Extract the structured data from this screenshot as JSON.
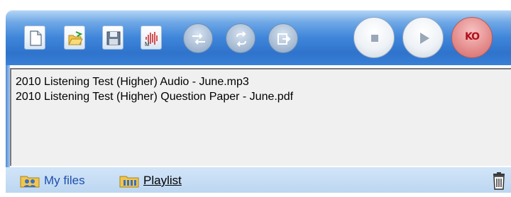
{
  "toolbar": {
    "buttons": [
      {
        "name": "new",
        "icon": "new-document-icon"
      },
      {
        "name": "open",
        "icon": "open-folder-icon"
      },
      {
        "name": "save",
        "icon": "save-disk-icon"
      },
      {
        "name": "media",
        "icon": "audio-waveform-icon"
      },
      {
        "name": "shuffle",
        "icon": "shuffle-icon"
      },
      {
        "name": "repeat",
        "icon": "repeat-icon"
      },
      {
        "name": "export",
        "icon": "export-icon"
      }
    ],
    "transport": {
      "stop": "stop-icon",
      "play": "play-icon",
      "record_label": "KO"
    }
  },
  "file_list": {
    "items": [
      "2010 Listening Test (Higher) Audio - June.mp3",
      "2010 Listening Test (Higher) Question Paper - June.pdf"
    ]
  },
  "tabs": {
    "my_files": "My files",
    "playlist": "Playlist"
  },
  "colors": {
    "toolbar_blue": "#3f86da",
    "record_red": "#b0101c",
    "tab_link": "#1f4fae"
  }
}
